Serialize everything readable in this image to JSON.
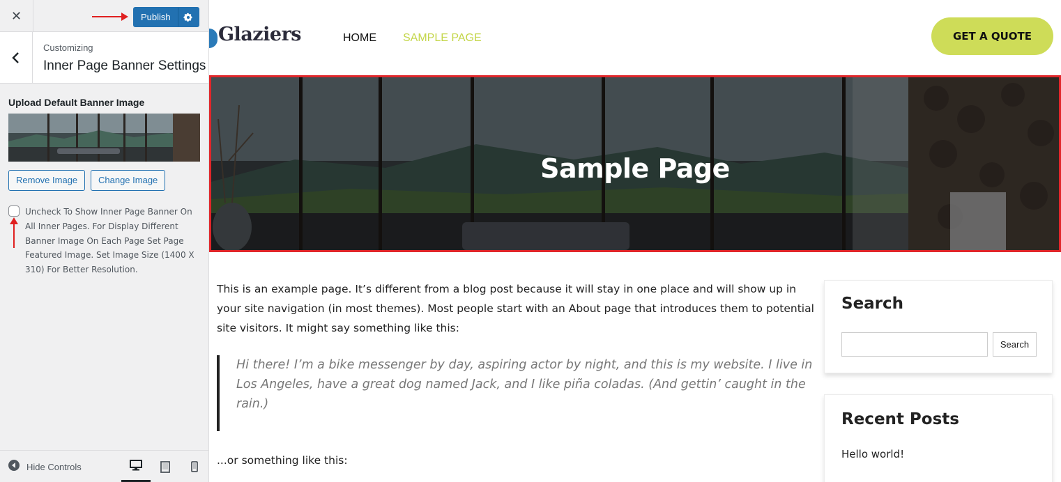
{
  "sidebar": {
    "close_icon": "✕",
    "publish_label": "Publish",
    "customizing_label": "Customizing",
    "section_title": "Inner Page Banner Settings",
    "control_title": "Upload Default Banner Image",
    "remove_image_label": "Remove Image",
    "change_image_label": "Change Image",
    "checkbox_label": "Uncheck To Show Inner Page Banner On All Inner Pages. For Display Different Banner Image On Each Page Set Page Featured Image. Set Image Size (1400 X 310) For Better Resolution.",
    "checkbox_checked": false,
    "hide_controls_label": "Hide Controls",
    "active_device": "desktop",
    "icons": [
      "close-icon",
      "gear-icon",
      "chevron-left-icon",
      "hide-controls-icon",
      "desktop-icon",
      "tablet-icon",
      "mobile-icon"
    ]
  },
  "site": {
    "logo_text": "Glaziers",
    "nav": [
      {
        "label": "HOME",
        "active": false
      },
      {
        "label": "SAMPLE PAGE",
        "active": true
      }
    ],
    "cta_label": "GET A QUOTE",
    "banner_title": "Sample Page",
    "content": {
      "intro": "This is an example page. It’s different from a blog post because it will stay in one place and will show up in your site navigation (in most themes). Most people start with an About page that introduces them to potential site visitors. It might say something like this:",
      "quote": "Hi there! I’m a bike messenger by day, aspiring actor by night, and this is my website. I live in Los Angeles, have a great dog named Jack, and I like piña coladas. (And gettin’ caught in the rain.)",
      "after_quote": "...or something like this:"
    },
    "widgets": {
      "search_title": "Search",
      "search_button": "Search",
      "search_value": "",
      "recent_posts_title": "Recent Posts",
      "recent_posts": [
        "Hello world!"
      ]
    }
  },
  "colors": {
    "accent_blue": "#2271b1",
    "highlight_red": "#e0262a",
    "brand_lime": "#cedc58"
  }
}
